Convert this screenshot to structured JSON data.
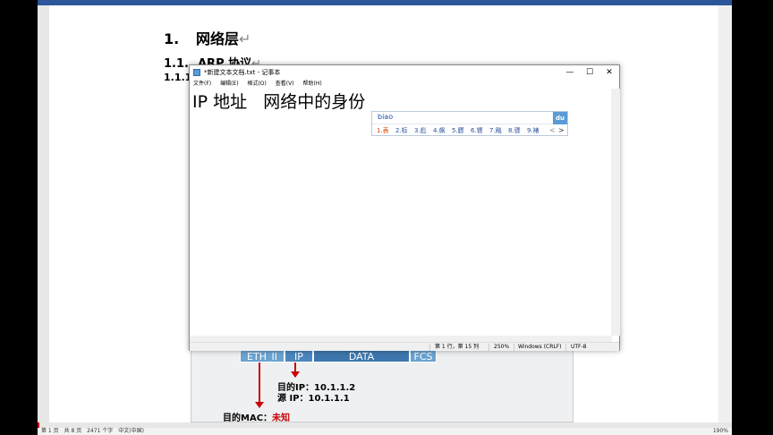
{
  "word": {
    "heading1": {
      "num": "1.",
      "text": "网络层"
    },
    "heading2": {
      "num": "1.1.",
      "text": "ARP 协议"
    },
    "heading3": {
      "num": "1.1.1"
    },
    "paragraph_mark": "↵",
    "figure": {
      "eth_label": "ETH_II",
      "ip_label": "IP",
      "data_label": "DATA",
      "fcs_label": "FCS",
      "dst_ip": "目的IP：10.1.1.2",
      "src_ip": "源  IP：10.1.1.1",
      "dst_mac_label": "目的MAC：",
      "dst_mac_value": "未知"
    },
    "status": {
      "page": "第 1 页",
      "total": "共 8 页",
      "words": "2471 个字",
      "lang": "中文(中国)",
      "zoom": "190%"
    }
  },
  "notepad": {
    "title": "*新建文本文档.txt - 记事本",
    "menu": [
      "文件(F)",
      "编辑(E)",
      "格式(O)",
      "查看(V)",
      "帮助(H)"
    ],
    "content": "IP 地址   网络中的身份",
    "status": {
      "position": "第 1 行，第 15 列",
      "zoom": "250%",
      "eol": "Windows (CRLF)",
      "encoding": "UTF-8"
    },
    "buttons": {
      "minimize": "—",
      "maximize": "☐",
      "close": "✕"
    }
  },
  "ime": {
    "pinyin": "biao",
    "logo": "du",
    "candidates": [
      "1.表",
      "2.标",
      "3.彪",
      "4.飙",
      "5.膘",
      "6.镖",
      "7.飚",
      "8.骠",
      "9.裱"
    ],
    "prev": "<",
    "next": ">"
  },
  "colors": {
    "accent": "#2b579a",
    "ime_selected": "#e04a00",
    "arrow": "#cc0000"
  }
}
